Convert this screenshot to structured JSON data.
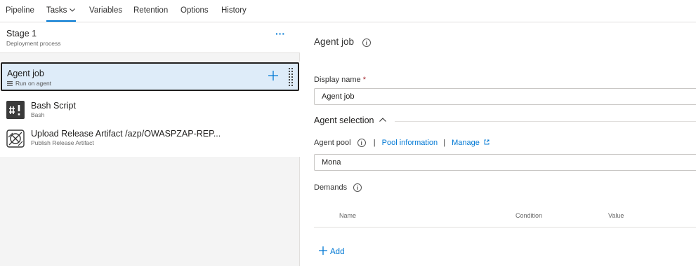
{
  "nav": {
    "tabs": [
      "Pipeline",
      "Tasks",
      "Variables",
      "Retention",
      "Options",
      "History"
    ],
    "active_tab": "Tasks"
  },
  "stage": {
    "title": "Stage 1",
    "subtitle": "Deployment process",
    "more_label": "···"
  },
  "agent_job": {
    "title": "Agent job",
    "subtitle": "Run on agent"
  },
  "tasks": [
    {
      "title": "Bash Script",
      "subtitle": "Bash",
      "icon": "bash-icon"
    },
    {
      "title": "Upload Release Artifact /azp/OWASPZAP-REP...",
      "subtitle": "Publish Release Artifact",
      "icon": "artifact-icon"
    }
  ],
  "details": {
    "title": "Agent job",
    "display_name_label": "Display name",
    "required_mark": "*",
    "display_name_value": "Agent job",
    "agent_selection_label": "Agent selection",
    "agent_pool_label": "Agent pool",
    "pool_info_link": "Pool information",
    "manage_link": "Manage",
    "agent_pool_value": "Mona",
    "demands_label": "Demands",
    "columns": [
      "Name",
      "Condition",
      "Value"
    ],
    "add_label": "Add"
  },
  "colors": {
    "accent": "#0078d4",
    "selected_bg": "#deecf9"
  }
}
